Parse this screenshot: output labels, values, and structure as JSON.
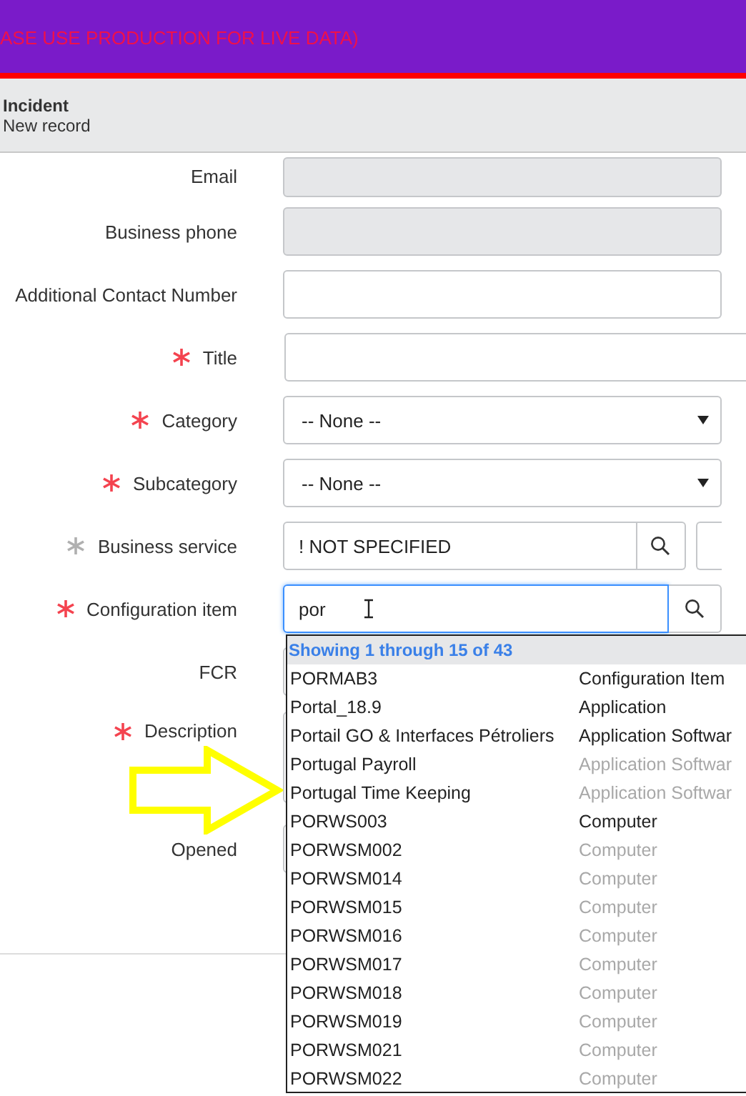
{
  "banner": {
    "text": "ASE USE PRODUCTION FOR LIVE DATA)"
  },
  "header": {
    "title": "Incident",
    "subtitle": "New record"
  },
  "fields": [
    {
      "label": "Email",
      "required": false,
      "kind": "readonly"
    },
    {
      "label": "Business phone",
      "required": false,
      "kind": "readonly"
    },
    {
      "label": "Additional Contact Number",
      "required": false,
      "kind": "text"
    },
    {
      "label": "Title",
      "required": true,
      "satisfied": false,
      "kind": "wide"
    },
    {
      "label": "Category",
      "required": true,
      "satisfied": false,
      "kind": "select",
      "value": "-- None --"
    },
    {
      "label": "Subcategory",
      "required": true,
      "satisfied": false,
      "kind": "select",
      "value": "-- None --"
    },
    {
      "label": "Business service",
      "required": true,
      "satisfied": true,
      "kind": "reference",
      "value": "! NOT SPECIFIED",
      "focused": false
    },
    {
      "label": "Configuration item",
      "required": true,
      "satisfied": false,
      "kind": "reference",
      "value": "por",
      "focused": true
    },
    {
      "label": "FCR",
      "required": false,
      "kind": "text"
    },
    {
      "label": "Description",
      "required": true,
      "satisfied": false,
      "kind": "textarea"
    },
    {
      "label": "Opened",
      "required": false,
      "kind": "text"
    }
  ],
  "dropdown": {
    "summary": "Showing 1 through 15 of 43",
    "items": [
      {
        "name": "PORMAB3",
        "class": "Configuration Item",
        "dimmed": false
      },
      {
        "name": "Portal_18.9",
        "class": "Application",
        "dimmed": false
      },
      {
        "name": "Portail GO & Interfaces Pétroliers",
        "class": "Application Softwar",
        "dimmed": false
      },
      {
        "name": "Portugal Payroll",
        "class": "Application Softwar",
        "dimmed": true
      },
      {
        "name": "Portugal Time Keeping",
        "class": "Application Softwar",
        "dimmed": true
      },
      {
        "name": "PORWS003",
        "class": "Computer",
        "dimmed": false
      },
      {
        "name": "PORWSM002",
        "class": "Computer",
        "dimmed": true
      },
      {
        "name": "PORWSM014",
        "class": "Computer",
        "dimmed": true
      },
      {
        "name": "PORWSM015",
        "class": "Computer",
        "dimmed": true
      },
      {
        "name": "PORWSM016",
        "class": "Computer",
        "dimmed": true
      },
      {
        "name": "PORWSM017",
        "class": "Computer",
        "dimmed": true
      },
      {
        "name": "PORWSM018",
        "class": "Computer",
        "dimmed": true
      },
      {
        "name": "PORWSM019",
        "class": "Computer",
        "dimmed": true
      },
      {
        "name": "PORWSM021",
        "class": "Computer",
        "dimmed": true
      },
      {
        "name": "PORWSM022",
        "class": "Computer",
        "dimmed": true
      }
    ]
  }
}
